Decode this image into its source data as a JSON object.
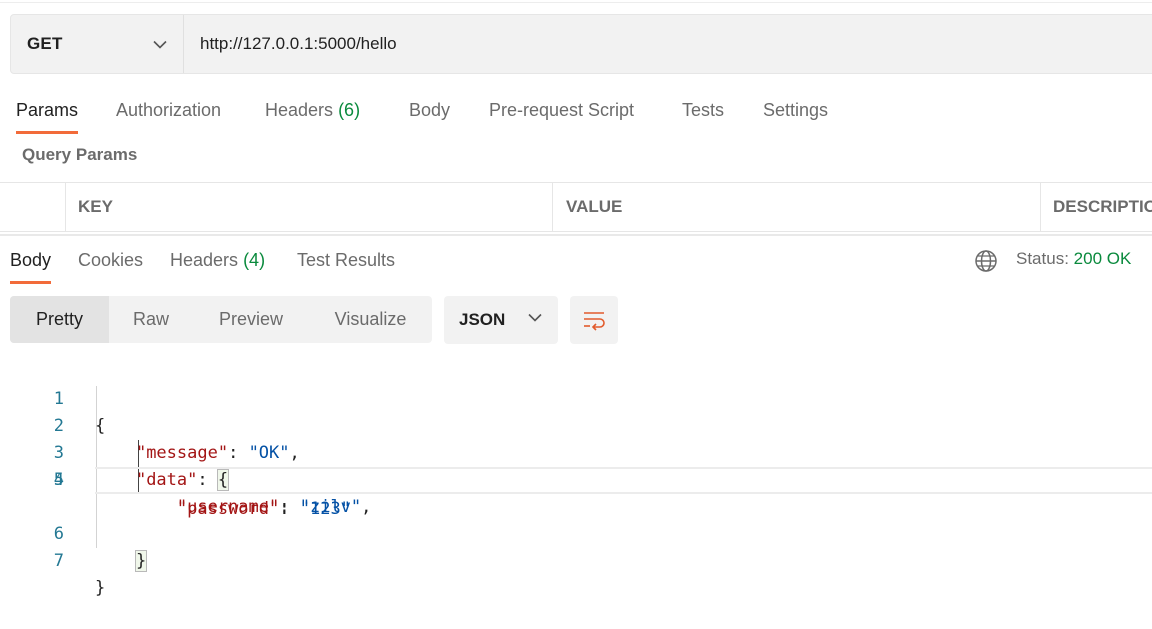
{
  "request": {
    "method": "GET",
    "url": "http://127.0.0.1:5000/hello"
  },
  "request_tabs": [
    {
      "label": "Params",
      "active": true
    },
    {
      "label": "Authorization"
    },
    {
      "label": "Headers",
      "count": "(6)"
    },
    {
      "label": "Body"
    },
    {
      "label": "Pre-request Script"
    },
    {
      "label": "Tests"
    },
    {
      "label": "Settings"
    }
  ],
  "query_params": {
    "title": "Query Params",
    "columns": [
      "KEY",
      "VALUE",
      "DESCRIPTIO"
    ]
  },
  "response_tabs": [
    {
      "label": "Body",
      "active": true
    },
    {
      "label": "Cookies"
    },
    {
      "label": "Headers",
      "count": "(4)"
    },
    {
      "label": "Test Results"
    }
  ],
  "status": {
    "label": "Status:",
    "value": "200 OK",
    "color": "#0a8a3d"
  },
  "view_modes": [
    "Pretty",
    "Raw",
    "Preview",
    "Visualize"
  ],
  "format": "JSON",
  "icons": {
    "method_chevron": "chevron-down-icon",
    "globe": "globe-icon",
    "wrap": "wrap-lines-icon"
  },
  "accent_color": "#f26b3a",
  "code": {
    "line_numbers": [
      "1",
      "2",
      "3",
      "4",
      "5",
      "6",
      "7"
    ],
    "lines": [
      {
        "open": "{"
      },
      {
        "key": "\"message\"",
        "sep": ": ",
        "value": "\"OK\"",
        "trail": ","
      },
      {
        "key": "\"data\"",
        "sep": ": ",
        "open": "{"
      },
      {
        "key": "\"username\"",
        "sep": ": ",
        "value": "\"zilv\"",
        "trail": ","
      },
      {
        "key": "\"password\"",
        "sep": ": ",
        "value": "\"123\""
      },
      {
        "close": "}"
      },
      {
        "close": "}"
      }
    ]
  }
}
